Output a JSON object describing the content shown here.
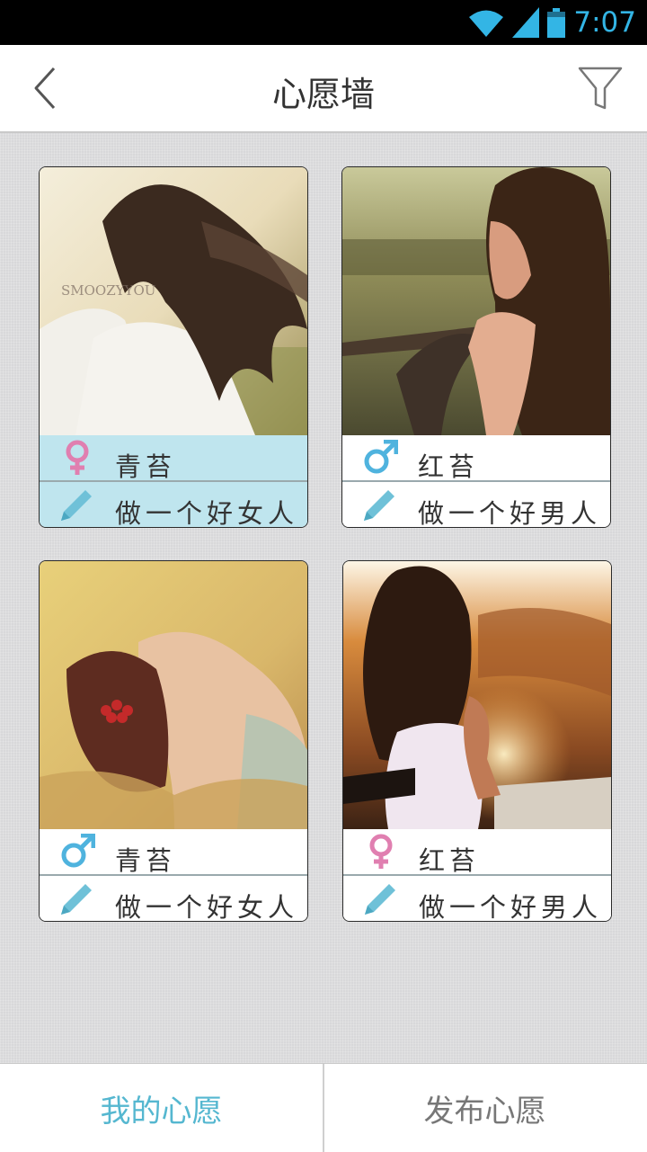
{
  "status": {
    "time": "7:07",
    "time_color": "#33b5e5"
  },
  "header": {
    "title": "心愿墙"
  },
  "cards": [
    {
      "gender": "female",
      "name": "青苔",
      "wish": "做一个好女人",
      "highlighted": true,
      "watermark": "SMOOZYYOU"
    },
    {
      "gender": "male",
      "name": "红苔",
      "wish": "做一个好男人",
      "highlighted": false
    },
    {
      "gender": "male",
      "name": "青苔",
      "wish": "做一个好女人",
      "highlighted": false
    },
    {
      "gender": "female",
      "name": "红苔",
      "wish": "做一个好男人",
      "highlighted": false
    }
  ],
  "bottom_tabs": [
    {
      "label": "我的心愿",
      "active": true
    },
    {
      "label": "发布心愿",
      "active": false
    }
  ],
  "colors": {
    "accent": "#55b7d0",
    "female": "#e07fb0",
    "male": "#4fb3de",
    "pencil": "#6fc1d8",
    "highlight_bg": "#bfe5ee"
  }
}
